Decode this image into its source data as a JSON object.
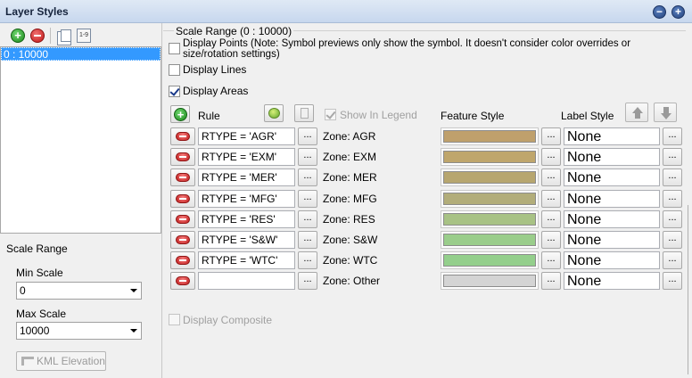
{
  "window": {
    "title": "Layer Styles"
  },
  "left": {
    "scale_items": [
      "0 : 10000"
    ],
    "scale_range_group_label": "Scale Range",
    "min_scale_label": "Min Scale",
    "min_scale_value": "0",
    "max_scale_label": "Max Scale",
    "max_scale_value": "10000",
    "kml_button_label": "KML Elevation"
  },
  "right": {
    "group_title": "Scale Range (0 : 10000)",
    "display_points_label": "Display Points (Note: Symbol previews only show the symbol. It doesn't consider color overrides or size/rotation settings)",
    "display_points_checked": false,
    "display_lines_label": "Display Lines",
    "display_lines_checked": false,
    "display_areas_label": "Display Areas",
    "display_areas_checked": true,
    "header": {
      "rule": "Rule",
      "show_in_legend": "Show In Legend",
      "feature_style": "Feature Style",
      "label_style": "Label Style"
    },
    "rules": [
      {
        "rule": "RTYPE = 'AGR'",
        "zone": "Zone:  AGR",
        "color": "#bfa06c",
        "label": "None"
      },
      {
        "rule": "RTYPE = 'EXM'",
        "zone": "Zone:  EXM",
        "color": "#bfa66c",
        "label": "None"
      },
      {
        "rule": "RTYPE = 'MER'",
        "zone": "Zone:  MER",
        "color": "#b7a66f",
        "label": "None"
      },
      {
        "rule": "RTYPE = 'MFG'",
        "zone": "Zone:  MFG",
        "color": "#b2ad7a",
        "label": "None"
      },
      {
        "rule": "RTYPE = 'RES'",
        "zone": "Zone:  RES",
        "color": "#a8c285",
        "label": "None"
      },
      {
        "rule": "RTYPE = 'S&W'",
        "zone": "Zone:  S&W",
        "color": "#9acd8b",
        "label": "None"
      },
      {
        "rule": "RTYPE = 'WTC'",
        "zone": "Zone:  WTC",
        "color": "#94cf8c",
        "label": "None"
      },
      {
        "rule": "",
        "zone": "Zone:  Other",
        "color": "#d4d4d4",
        "label": "None"
      }
    ],
    "dots_label": "...",
    "display_composite_label": "Display Composite"
  }
}
